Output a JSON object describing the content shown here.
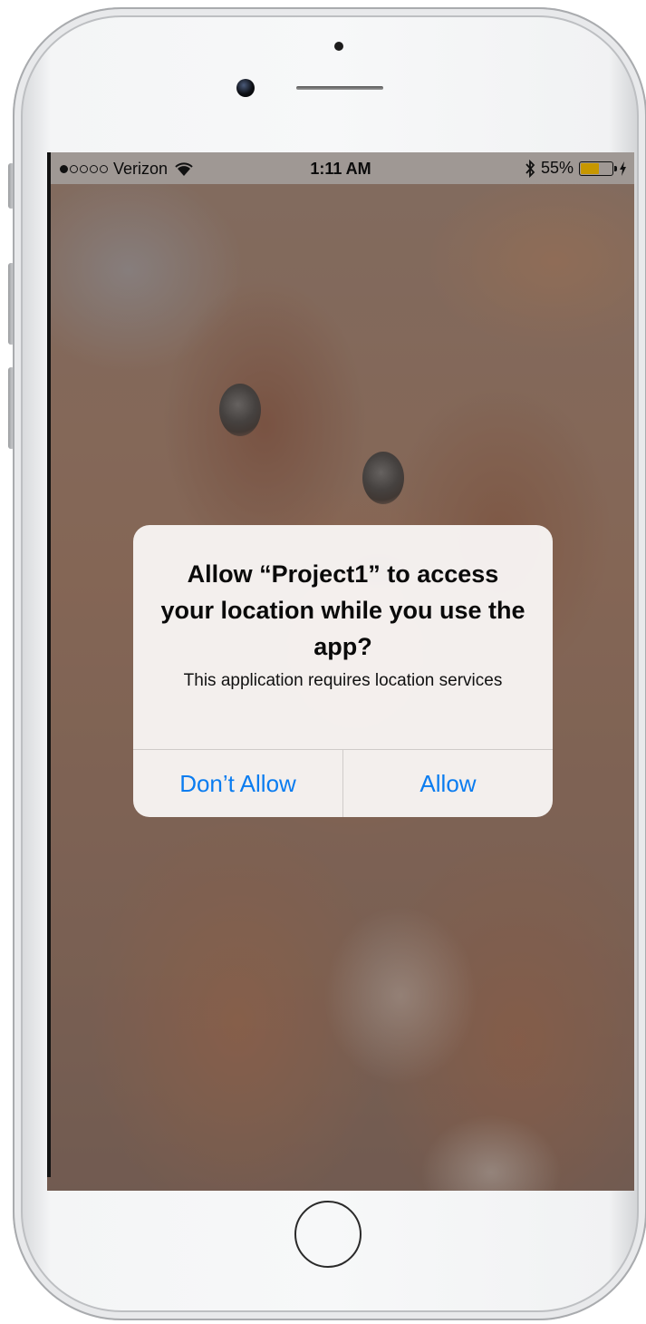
{
  "status_bar": {
    "carrier": "Verizon",
    "time": "1:11 AM",
    "battery_percent": "55%",
    "battery_level": 0.55,
    "signal_bars_filled": 1,
    "signal_bars_total": 5,
    "icons": [
      "wifi-icon",
      "bluetooth-icon",
      "battery-icon",
      "charging-bolt-icon"
    ]
  },
  "alert": {
    "title": "Allow “Project1” to access your location while you use the app?",
    "message": "This application requires location services",
    "buttons": {
      "deny_label": "Don’t Allow",
      "allow_label": "Allow"
    },
    "button_color": "#0a7cf0"
  },
  "background": {
    "description_colors": [
      "#8e6148",
      "#7d5744"
    ]
  }
}
